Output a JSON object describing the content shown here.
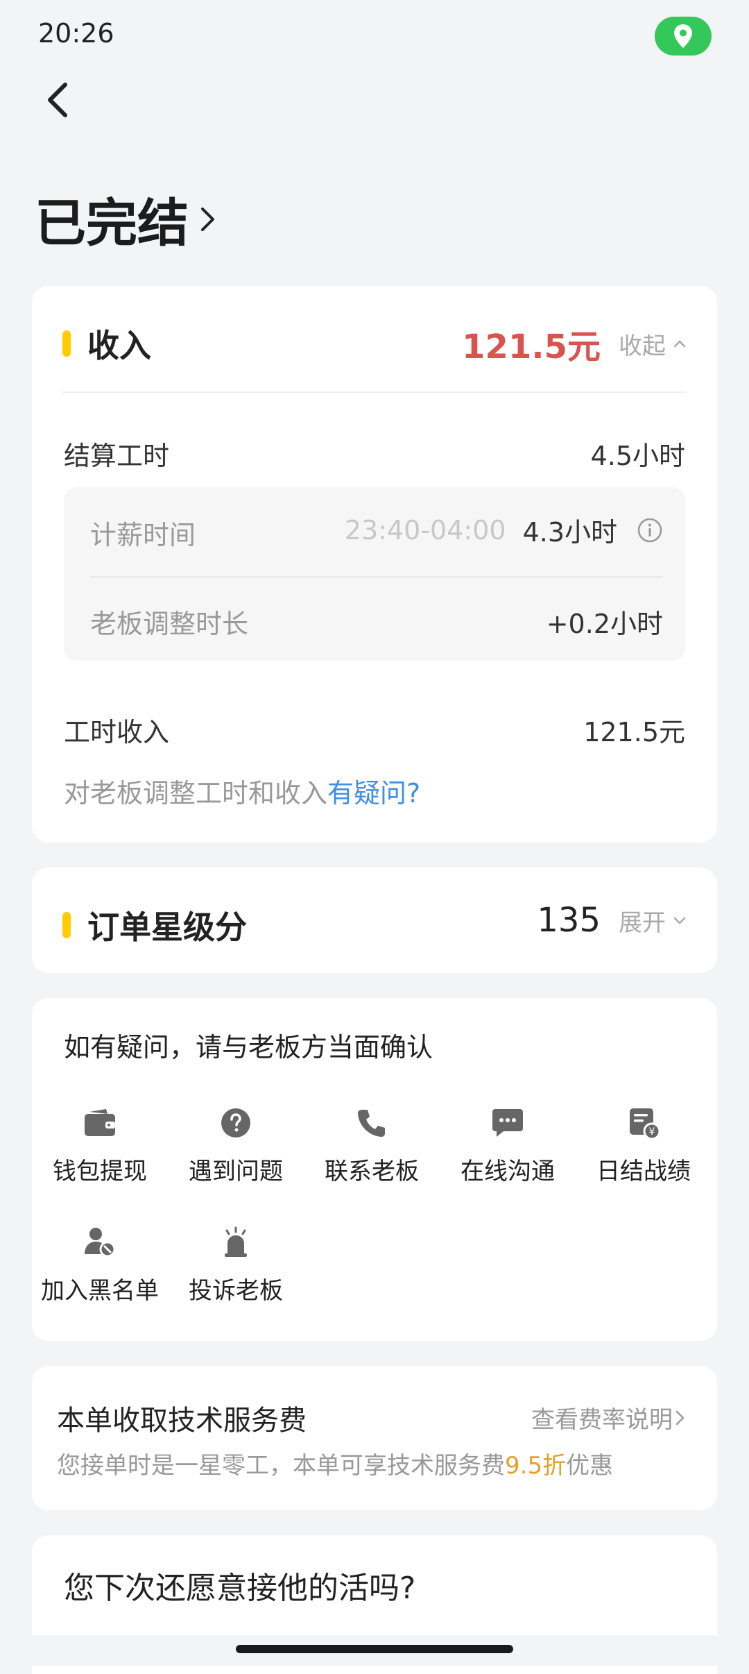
{
  "status_bar": {
    "time": "20:26"
  },
  "header": {
    "title": "已完结"
  },
  "income": {
    "title": "收入",
    "total": "121.5元",
    "toggle_label": "收起",
    "settle_label": "结算工时",
    "settle_value": "4.5小时",
    "pay_time_label": "计薪时间",
    "pay_time_range": "23:40-04:00",
    "pay_time_value": "4.3小时",
    "boss_adjust_label": "老板调整时长",
    "boss_adjust_value": "+0.2小时",
    "hour_income_label": "工时收入",
    "hour_income_value": "121.5元",
    "question_prefix": "对老板调整工时和收入",
    "question_link": "有疑问?"
  },
  "star": {
    "title": "订单星级分",
    "value": "135",
    "toggle_label": "展开"
  },
  "help": {
    "title": "如有疑问，请与老板方当面确认",
    "actions": [
      {
        "label": "钱包提现",
        "icon": "wallet-icon"
      },
      {
        "label": "遇到问题",
        "icon": "question-icon"
      },
      {
        "label": "联系老板",
        "icon": "phone-icon"
      },
      {
        "label": "在线沟通",
        "icon": "chat-icon"
      },
      {
        "label": "日结战绩",
        "icon": "daily-record-icon"
      },
      {
        "label": "加入黑名单",
        "icon": "block-user-icon"
      },
      {
        "label": "投诉老板",
        "icon": "alarm-icon"
      }
    ]
  },
  "fee": {
    "title": "本单收取技术服务费",
    "link": "查看费率说明",
    "desc_prefix": "您接单时是一星零工，本单可享技术服务费",
    "desc_highlight": "9.5折",
    "desc_suffix": "优惠"
  },
  "next_question": {
    "title": "您下次还愿意接他的活吗?"
  },
  "colors": {
    "accent_red": "#d9534f",
    "link_blue": "#3f8ee8",
    "highlight_orange": "#e3a02a",
    "bar_yellow": "#ffcc00",
    "location_green": "#34c759"
  }
}
